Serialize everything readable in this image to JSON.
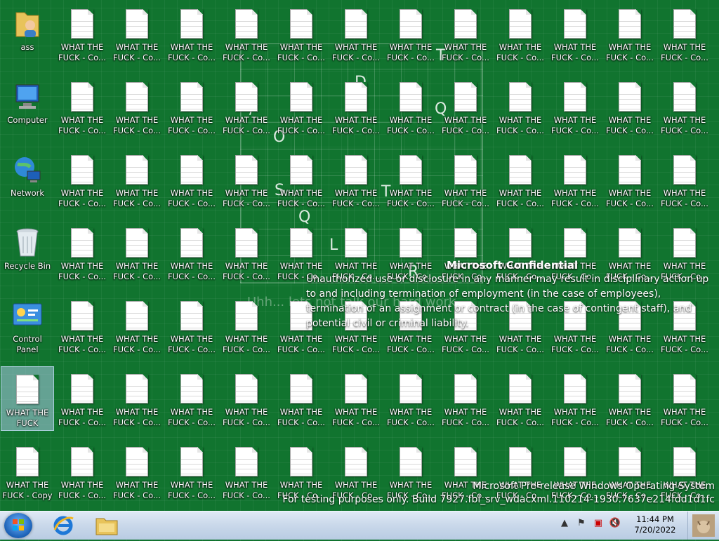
{
  "desktop": {
    "system_icons": [
      {
        "label": "ass",
        "icon": "user-folder-icon"
      },
      {
        "label": "Computer",
        "icon": "computer-icon"
      },
      {
        "label": "Network",
        "icon": "network-icon"
      },
      {
        "label": "Recycle Bin",
        "icon": "recycle-bin-icon"
      },
      {
        "label": "Control Panel",
        "icon": "control-panel-icon"
      },
      {
        "label": "WHAT THE\nFUCK",
        "icon": "document-icon",
        "selected": true
      },
      {
        "label": "WHAT THE\nFUCK - Copy",
        "icon": "document-icon"
      }
    ],
    "file_icon_label": "WHAT THE\nFUCK - Co...",
    "file_columns": 12,
    "file_rows": 7,
    "overlay_letters": [
      "T",
      "D",
      "Q",
      "O",
      "S",
      "T",
      "Q",
      "L",
      "R",
      "/",
      "S"
    ],
    "confidential": {
      "title": "Microsoft Confidential",
      "body": "Unauthorized use or disclosure in any manner may result in disciplinary action up to and including termination of employment (in the case of employees), termination of an assignment or contract (in the case of contingent staff), and potential civil or criminal liability."
    },
    "ghost_text": "Uhh... lets not talk our hard work",
    "watermark": {
      "line1": "Microsoft Pre-release Windows Operating System",
      "line2": "For testing purposes only. Build 7927.fbl_srv_wdacxml.110214-1930.7637e214fdd1d1fc"
    }
  },
  "taskbar": {
    "pinned": [
      {
        "name": "internet-explorer-icon"
      },
      {
        "name": "windows-explorer-icon"
      }
    ],
    "clock": {
      "time": "11:44 PM",
      "date": "7/20/2022"
    }
  },
  "colors": {
    "desktop_bg": "#11742f",
    "taskbar_bg": "#c9d8ea"
  }
}
